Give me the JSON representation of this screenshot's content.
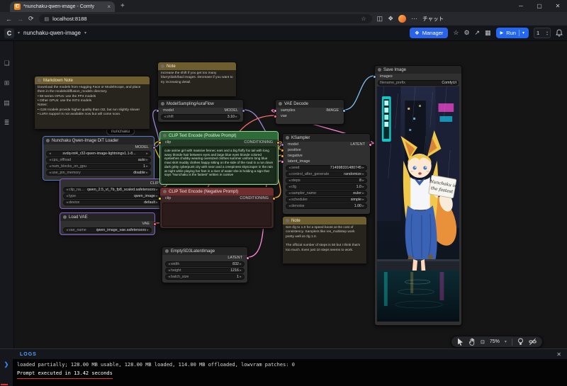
{
  "colors": {
    "accent_blue": "#2468f2",
    "manager_blue": "#2b63e8",
    "positive_green": "#2f6b38",
    "negative_red": "#6e2e2e",
    "note_olive": "#6e5d2e",
    "log_accent": "#4ea1ff",
    "annotation_red": "#e03131",
    "wire_model": "#9e86d8",
    "wire_clip": "#f5d516",
    "wire_vae": "#ff6e6e",
    "wire_conditioning": "#ffa840",
    "wire_latent": "#ff8ad8",
    "wire_image": "#7ec3f7"
  },
  "icons": {
    "chevron_down": "▾",
    "close_small": "×",
    "close_x": "✕",
    "plus": "+",
    "back": "←",
    "forward": "→",
    "refresh": "⟳",
    "star": "☆",
    "share": "↗",
    "settings": "⚙",
    "apps_grid": "▦",
    "split_screen": "◫",
    "extensions": "❖",
    "menu_dots": "⋯",
    "site_info": "▤",
    "run": "▶",
    "minimize": "─",
    "maximize": "▢",
    "up": "▴",
    "down": "▾",
    "prompt_chevron": "❯",
    "fit_view": "⊡",
    "workflows": "❏",
    "node_library": "⊞",
    "model_library": "▤",
    "queue": "≣"
  },
  "browser": {
    "favicon_letter": "C",
    "tab_title": "*nunchaku-qwen-image - Comfy",
    "url": "localhost:8188",
    "chat_label": "チャット"
  },
  "topbar": {
    "logo_letter": "C",
    "workflow_name": "nunchaku-qwen-image",
    "manager": "Manager",
    "run": "Run",
    "batch_count": "1"
  },
  "workflow_tab": "nunchaku-qwen-image",
  "group_pill": "nunchaku",
  "canvas_toolbar": {
    "zoom": "75%"
  },
  "image_sign": {
    "line1": "Nunchaku is",
    "line2": "the fastest"
  },
  "nodes": {
    "markdown_note": {
      "title": "Markdown Note",
      "body": "Download the models from Hugging Face or ModelScope, and place them in the models/diffusion_models directory.\n• 50-series GPUs: use the FP4 models\n• Other GPUs: use the INT4 models\nNotes:\n• r128 models provide higher quality than r32, but run slightly slower\n• LoRA support is not available now but will come soon."
    },
    "note_top": {
      "title": "Note",
      "body": "Increase the shift if you get too many blurry/dark/bad images. Decrease if you want to try increasing detail."
    },
    "model_sampling": {
      "title": "ModelSamplingAuraFlow",
      "in0": "model",
      "out0": "MODEL",
      "w0l": "shift",
      "w0v": "3.10"
    },
    "dit_loader": {
      "title": "Nunchaku Qwen-Image DiT Loader",
      "out0": "MODEL",
      "w0v": "svdq-int4_r32-qwen-image-lightningv1.1-8...",
      "w1l": "cpu_offload",
      "w1v": "auto",
      "w2l": "num_blocks_on_gpu",
      "w2v": "1",
      "w3l": "use_pin_memory",
      "w3v": "disable"
    },
    "clip_loader": {
      "out0": "CLIP",
      "w0l": "clip_name",
      "w0v": "qwen_2.5_vl_7b_fp8_scaled.safetensors",
      "w1l": "type",
      "w1v": "qwen_image",
      "w2l": "device",
      "w2v": "default"
    },
    "load_vae": {
      "title": "Load VAE",
      "out0": "VAE",
      "w0l": "vae_name",
      "w0v": "qwen_image_vae.safetensors"
    },
    "positive": {
      "title": "CLIP Text Encode (Positive Prompt)",
      "in0": "clip",
      "out0": "CONDITIONING",
      "text": "cute anime girl with massive fennec ears and a big fluffy fox tail with long wavy blonde hair between eyes and large blue eyes blonde colored eyelashes chubby wearing oversized clothes summer uniform long blue maxi skirt muddy clothes happy sitting on the side of the road in a run down dark gritty cyberpunk city with neon and a creepiness skyscraper in the rain at night while playing her feet in a river of water she is holding a sign that says \"Nunchaku is the fastest\" written in cursive"
    },
    "negative": {
      "title": "CLIP Text Encode (Negative Prompt)",
      "in0": "clip",
      "out0": "CONDITIONING",
      "text": ""
    },
    "empty_latent": {
      "title": "EmptySD3LatentImage",
      "out0": "LATENT",
      "w0l": "width",
      "w0v": "832",
      "w1l": "height",
      "w1v": "1216",
      "w2l": "batch_size",
      "w2v": "1"
    },
    "vae_decode": {
      "title": "VAE Decode",
      "in0": "samples",
      "in1": "vae",
      "out0": "IMAGE"
    },
    "ksampler": {
      "title": "KSampler",
      "in0": "model",
      "in1": "positive",
      "in2": "negative",
      "in3": "latent_image",
      "out0": "LATENT",
      "w0l": "seed",
      "w0v": "714998331480745",
      "w1l": "control_after_generate",
      "w1v": "randomize",
      "w2l": "steps",
      "w2v": "8",
      "w3l": "cfg",
      "w3v": "1.0",
      "w4l": "sampler_name",
      "w4v": "euler",
      "w5l": "scheduler",
      "w5v": "simple",
      "w6l": "denoise",
      "w6v": "1.00"
    },
    "note_right": {
      "title": "Note",
      "body": "Set cfg to 1.0 for a speed boost at the cost of consistency. Samplers like res_multistep work pretty well at cfg 1.0.\n\nThe official number of steps is 50 but I think that's too much. Even just 10 steps seems to work."
    },
    "save_image": {
      "title": "Save Image",
      "in0": "images",
      "w0l": "filename_prefix",
      "w0v": "ComfyUI"
    }
  },
  "logs": {
    "title": "LOGS",
    "line1": "loaded partially; 128.00 MB usable, 128.00 MB loaded, 114.00 MB offloaded, lowvram patches: 0",
    "line2": "Prompt executed in 13.42 seconds"
  }
}
